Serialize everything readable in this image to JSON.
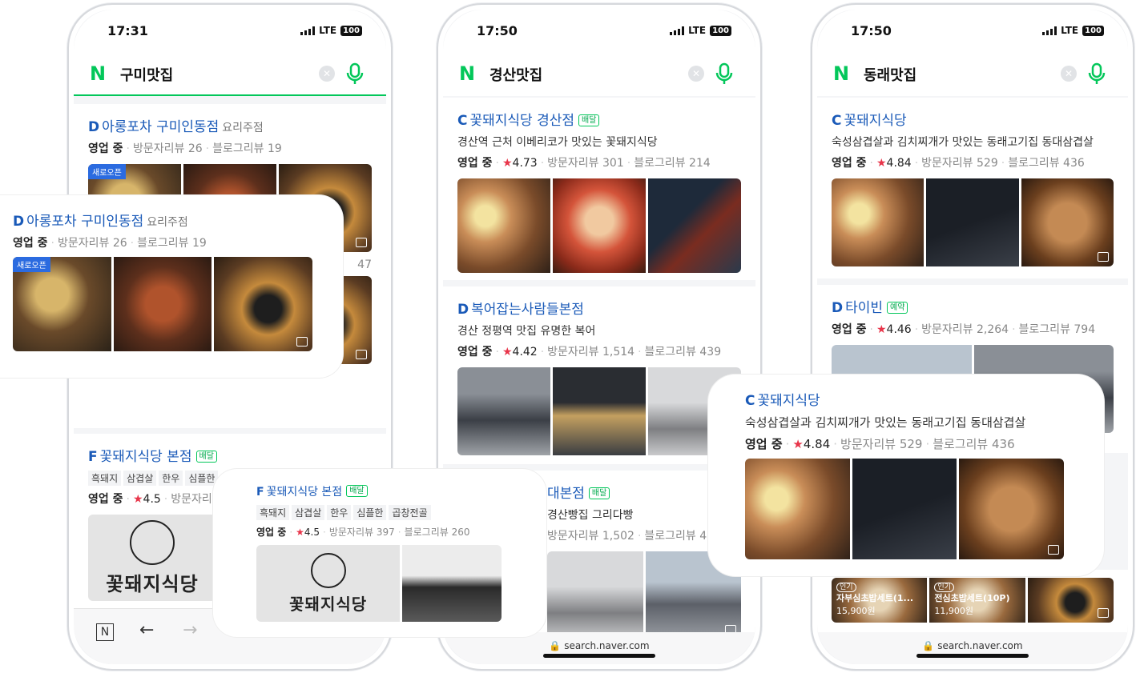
{
  "phones": [
    {
      "time": "17:31",
      "network": "LTE",
      "battery": "100",
      "query": "구미맛집",
      "results": [
        {
          "grade": "D",
          "name": "아롱포차 구미인동점",
          "category": "요리주점",
          "status": "영업 중",
          "visitor_reviews": "방문자리뷰 26",
          "blog_reviews": "블로그리뷰 19",
          "photo_badge": "새로오픈"
        },
        {
          "grade": "F",
          "name": "꽃돼지식당 본점",
          "badge": "배달",
          "tags": [
            "흑돼지",
            "삼겹살",
            "한우",
            "심플한",
            "곱창전골"
          ],
          "status": "영업 중",
          "rating": "4.5",
          "visitor_reviews": "방문자리"
        }
      ],
      "partial_text": "47",
      "logo_text": "꽃돼지식당"
    },
    {
      "time": "17:50",
      "network": "LTE",
      "battery": "100",
      "query": "경산맛집",
      "results": [
        {
          "grade": "C",
          "name": "꽃돼지식당 경산점",
          "badge": "배달",
          "description": "경산역 근처 이베리코가 맛있는 꽃돼지식당",
          "status": "영업 중",
          "rating": "4.73",
          "visitor_reviews": "방문자리뷰 301",
          "blog_reviews": "블로그리뷰 214"
        },
        {
          "grade": "D",
          "name": "복어잡는사람들본점",
          "description": "경산 정평역 맛집 유명한 복어",
          "status": "영업 중",
          "rating": "4.42",
          "visitor_reviews": "방문자리뷰 1,514",
          "blog_reviews": "블로그리뷰 439"
        },
        {
          "name": "대본점",
          "badge": "배달",
          "description": "경산빵집 그리다빵",
          "visitor_reviews": "방문자리뷰 1,502",
          "blog_reviews": "블로그리뷰 4"
        }
      ],
      "url": "search.naver.com"
    },
    {
      "time": "17:50",
      "network": "LTE",
      "battery": "100",
      "query": "동래맛집",
      "results": [
        {
          "grade": "C",
          "name": "꽃돼지식당",
          "description": "숙성삼겹살과 김치찌개가 맛있는 동래고기집 동대삼겹살",
          "status": "영업 중",
          "rating": "4.84",
          "visitor_reviews": "방문자리뷰 529",
          "blog_reviews": "블로그리뷰 436"
        },
        {
          "grade": "D",
          "name": "타이빈",
          "badge": "예약",
          "status": "영업 중",
          "rating": "4.46",
          "visitor_reviews": "방문자리뷰 2,264",
          "blog_reviews": "블로그리뷰 794"
        }
      ],
      "menu_items": [
        {
          "tag": "인기",
          "name": "자부심초밥세트(1...",
          "price": "15,900원"
        },
        {
          "tag": "인기",
          "name": "전심초밥세트(10P)",
          "price": "11,900원"
        }
      ],
      "url": "search.naver.com"
    }
  ],
  "popups": {
    "left": {
      "grade": "D",
      "name": "아롱포차 구미인동점",
      "category": "요리주점",
      "status": "영업 중",
      "visitor_reviews": "방문자리뷰 26",
      "blog_reviews": "블로그리뷰 19",
      "photo_badge": "새로오픈"
    },
    "middle": {
      "grade": "F",
      "name": "꽃돼지식당 본점",
      "badge": "배달",
      "tags": [
        "흑돼지",
        "삼겹살",
        "한우",
        "심플한",
        "곱창전골"
      ],
      "status": "영업 중",
      "rating": "4.5",
      "visitor_reviews": "방문자리뷰 397",
      "blog_reviews": "블로그리뷰 260",
      "logo_text": "꽃돼지식당"
    },
    "right": {
      "grade": "C",
      "name": "꽃돼지식당",
      "description": "숙성삼겹살과 김치찌개가 맛있는 동래고기집 동대삼겹살",
      "status": "영업 중",
      "rating": "4.84",
      "visitor_reviews": "방문자리뷰 529",
      "blog_reviews": "블로그리뷰 436"
    }
  },
  "icons": {
    "naver_logo": "N",
    "star": "★"
  },
  "colors": {
    "naver_green": "#03c75a",
    "title_blue": "#1a5ab8",
    "star_red": "#e8354a"
  }
}
